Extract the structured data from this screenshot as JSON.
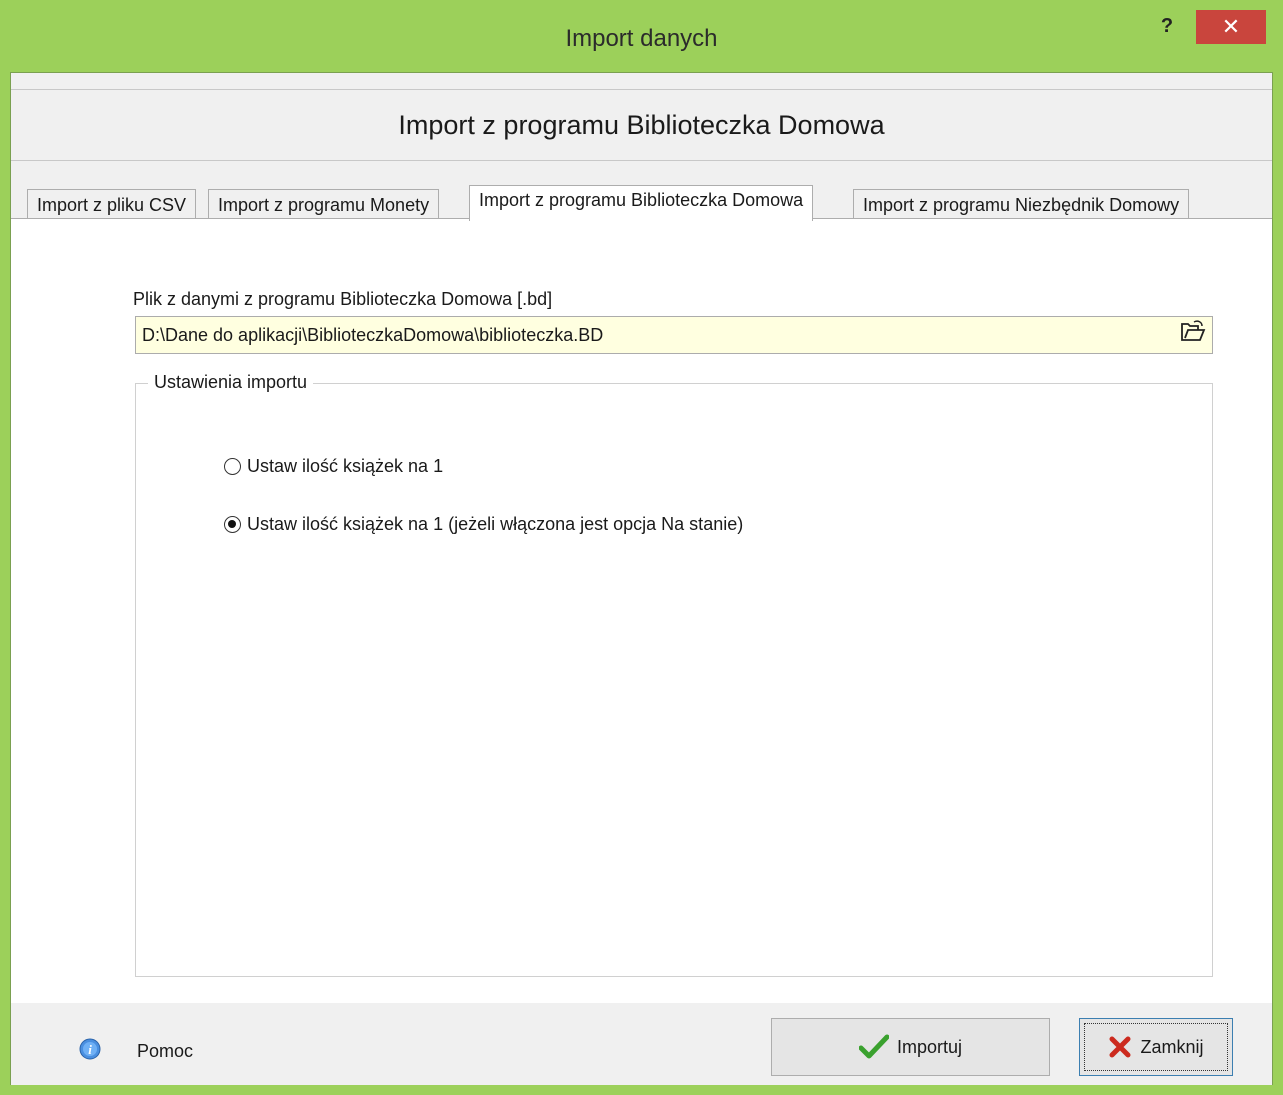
{
  "window": {
    "title": "Import danych",
    "help_glyph": "?",
    "close_glyph": "✕"
  },
  "header": {
    "title": "Import z programu Biblioteczka Domowa"
  },
  "tabs": [
    {
      "label": "Import z pliku CSV",
      "active": false
    },
    {
      "label": "Import z programu Monety",
      "active": false
    },
    {
      "label": "Import z programu Biblioteczka Domowa",
      "active": true
    },
    {
      "label": "Import z programu Niezbędnik Domowy",
      "active": false
    }
  ],
  "panel": {
    "file_label": "Plik z danymi z programu Biblioteczka Domowa [.bd]",
    "file_value": "D:\\Dane do aplikacji\\BiblioteczkaDomowa\\biblioteczka.BD",
    "browse_icon": "folder-open-icon",
    "group_title": "Ustawienia importu",
    "options": [
      {
        "label": "Ustaw ilość książek na 1",
        "checked": false
      },
      {
        "label": "Ustaw ilość książek na 1 (jeżeli włączona jest opcja Na stanie)",
        "checked": true
      }
    ]
  },
  "footer": {
    "help_label": "Pomoc",
    "import_label": "Importuj",
    "close_label": "Zamknij"
  },
  "colors": {
    "titlebar": "#9cd05a",
    "close_button": "#c9453d",
    "file_field_bg": "#ffffe0"
  }
}
